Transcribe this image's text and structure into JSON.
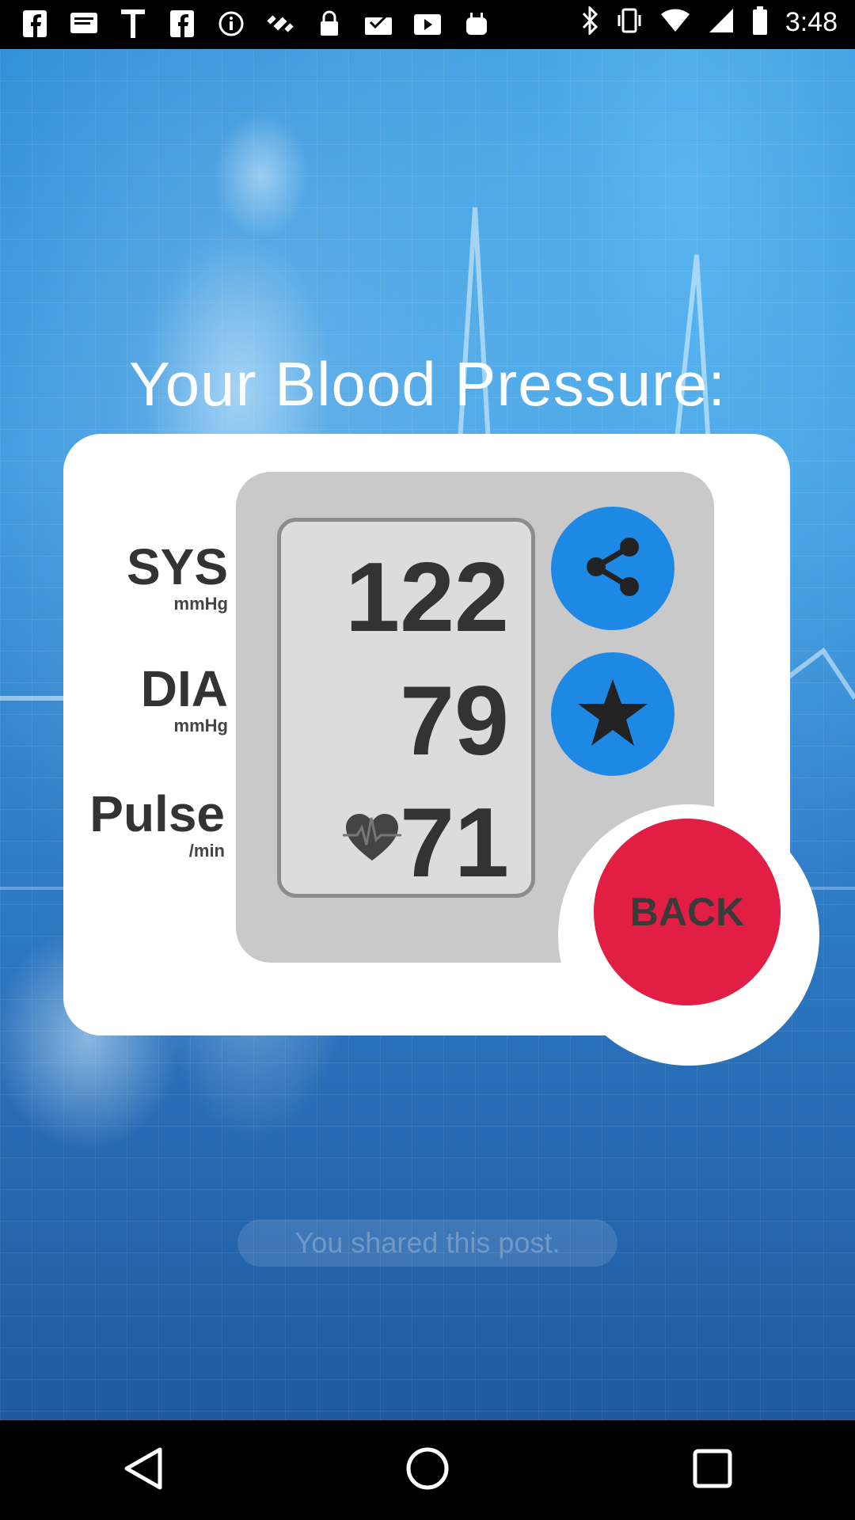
{
  "status_bar": {
    "time": "3:48",
    "left_icons": [
      "facebook-icon",
      "message-icon",
      "t-icon",
      "facebook-icon",
      "info-icon",
      "satellite-icon",
      "lock-icon",
      "inbox-icon",
      "play-store-icon",
      "android-icon"
    ],
    "right_icons": [
      "bluetooth-icon",
      "vibrate-icon",
      "wifi-icon",
      "signal-icon",
      "battery-icon"
    ]
  },
  "headline": "Your Blood Pressure:",
  "labels": {
    "sys": {
      "main": "SYS",
      "unit": "mmHg"
    },
    "dia": {
      "main": "DIA",
      "unit": "mmHg"
    },
    "pulse": {
      "main": "Pulse",
      "unit": "/min"
    }
  },
  "readings": {
    "sys": "122",
    "dia": "79",
    "pulse": "71"
  },
  "buttons": {
    "share_icon": "share-icon",
    "rate_icon": "star-icon",
    "back_label": "BACK"
  },
  "toast": "You shared this post.",
  "colors": {
    "accent_blue": "#1e88e5",
    "back_red": "#e31e44"
  },
  "nav_bar": [
    "back-icon",
    "home-icon",
    "recents-icon"
  ]
}
